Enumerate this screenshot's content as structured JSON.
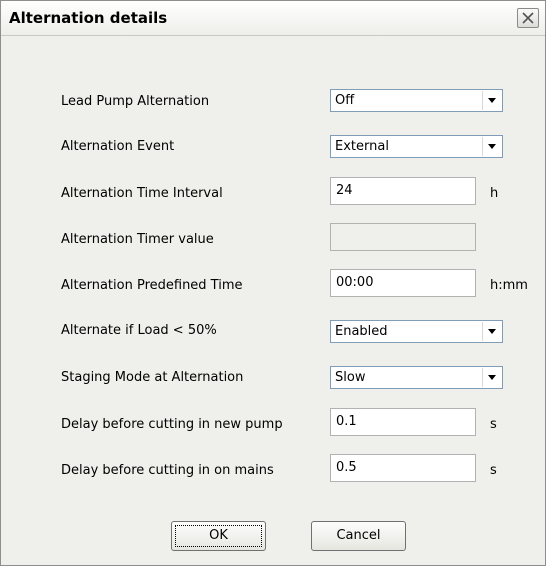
{
  "window": {
    "title": "Alternation details"
  },
  "fields": {
    "lead_pump_alternation": {
      "label": "Lead Pump Alternation",
      "value": "Off"
    },
    "alternation_event": {
      "label": "Alternation Event",
      "value": "External"
    },
    "alternation_time_interval": {
      "label": "Alternation Time Interval",
      "value": "24",
      "unit": "h"
    },
    "alternation_timer_value": {
      "label": "Alternation Timer value",
      "value": ""
    },
    "alternation_predefined_time": {
      "label": "Alternation Predefined Time",
      "value": "00:00",
      "unit": "h:mm"
    },
    "alternate_if_load": {
      "label": "Alternate if Load < 50%",
      "value": "Enabled"
    },
    "staging_mode": {
      "label": "Staging Mode at Alternation",
      "value": "Slow"
    },
    "delay_new_pump": {
      "label": "Delay before cutting in new pump",
      "value": "0.1",
      "unit": "s"
    },
    "delay_on_mains": {
      "label": "Delay before cutting in on mains",
      "value": "0.5",
      "unit": "s"
    }
  },
  "buttons": {
    "ok": "OK",
    "cancel": "Cancel"
  }
}
